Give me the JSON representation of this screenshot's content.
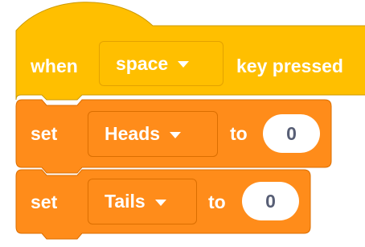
{
  "colors": {
    "events": "#FFBF00",
    "events_border": "#CC9900",
    "variables": "#FF8C1A",
    "variables_border": "#DB6E00",
    "text": "#FFFFFF",
    "number_text": "#575E75"
  },
  "hat_block": {
    "label_when": "when",
    "key_dropdown": {
      "value": "space",
      "icon": "dropdown-arrow-icon"
    },
    "label_key_pressed": "key pressed"
  },
  "set_blocks": [
    {
      "label_set": "set",
      "variable": "Heads",
      "label_to": "to",
      "value": "0"
    },
    {
      "label_set": "set",
      "variable": "Tails",
      "label_to": "to",
      "value": "0"
    }
  ]
}
